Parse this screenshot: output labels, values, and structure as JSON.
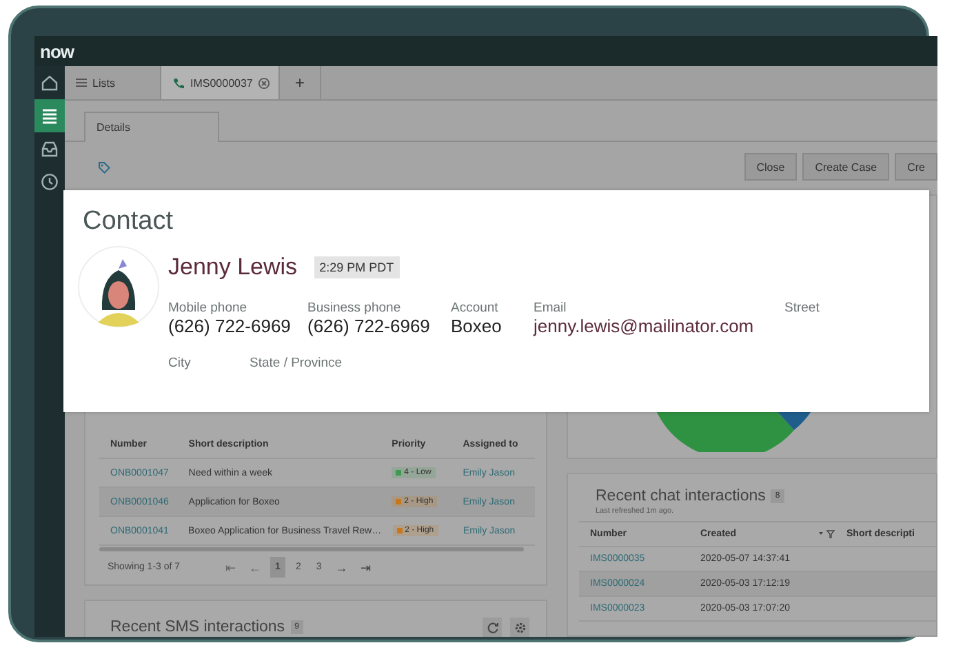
{
  "app": {
    "logo": "now"
  },
  "rail": [
    {
      "kind": "home",
      "selected": false
    },
    {
      "kind": "list",
      "selected": true
    },
    {
      "kind": "inbox",
      "selected": false
    },
    {
      "kind": "history",
      "selected": false
    }
  ],
  "tabs": [
    {
      "kind": "list",
      "label": "Lists",
      "selected": false
    },
    {
      "kind": "call",
      "label": "IMS0000037",
      "selected": true
    },
    {
      "kind": "add",
      "label": "+",
      "selected": false
    }
  ],
  "subtabs": [
    {
      "label": "Details",
      "selected": true
    }
  ],
  "toolbar": {
    "buttons": [
      "Close",
      "Create Case",
      "Cre"
    ]
  },
  "contact": {
    "title": "Contact",
    "name": "Jenny Lewis",
    "local_time": "2:29 PM PDT",
    "fields": [
      {
        "label": "Mobile phone",
        "value": "(626) 722-6969",
        "kind": "text"
      },
      {
        "label": "Business phone",
        "value": "(626) 722-6969",
        "kind": "text"
      },
      {
        "label": "Account",
        "value": "Boxeo",
        "kind": "text"
      },
      {
        "label": "Email",
        "value": "jenny.lewis@mailinator.com",
        "kind": "link"
      },
      {
        "label": "Street",
        "kind": "empty"
      }
    ],
    "fields_row2": [
      {
        "label": "City"
      },
      {
        "label": "State / Province"
      }
    ]
  },
  "cases": {
    "columns": [
      "Number",
      "Short description",
      "Priority",
      "Assigned to"
    ],
    "rows": [
      {
        "number": "ONB0001047",
        "description": "Need within a week",
        "priority": "4 - Low",
        "color": "#3f9a4f",
        "assigned": "Emily Jason"
      },
      {
        "number": "ONB0001046",
        "description": "Application for Boxeo",
        "priority": "2 - High",
        "color": "#c7781f",
        "assigned": "Emily Jason"
      },
      {
        "number": "ONB0001041",
        "description": "Boxeo Application for Business Travel Rew…",
        "priority": "2 - High",
        "color": "#c7781f",
        "assigned": "Emily Jason"
      }
    ],
    "footer": "Showing 1-3 of 7",
    "pagination": {
      "first": "⇤",
      "prev": "←",
      "pages": [
        {
          "label": "1",
          "selected": true
        },
        {
          "label": "2",
          "selected": false
        },
        {
          "label": "3",
          "selected": false
        }
      ],
      "next": "→",
      "last": "⇥"
    }
  },
  "sms": {
    "title": "Recent SMS interactions",
    "count": "9"
  },
  "chat": {
    "title": "Recent chat interactions",
    "count": "8",
    "subtitle": "Last refreshed 1m ago.",
    "columns": [
      "Number",
      "Created",
      "Short descripti"
    ],
    "rows": [
      {
        "number": "IMS0000035",
        "created": "2020-05-07 14:37:41"
      },
      {
        "number": "IMS0000024",
        "created": "2020-05-03 17:12:19"
      },
      {
        "number": "IMS0000023",
        "created": "2020-05-03 17:07:20"
      }
    ]
  }
}
